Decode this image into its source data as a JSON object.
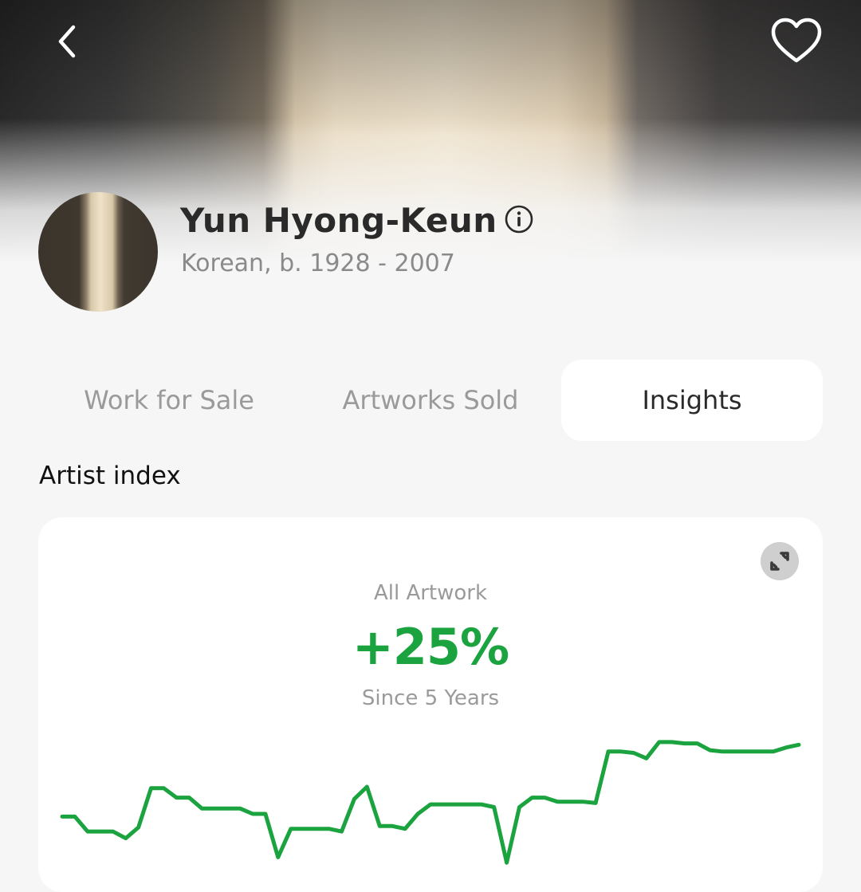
{
  "header": {
    "back_icon": "chevron-left-icon",
    "favorite_icon": "heart-outline-icon"
  },
  "artist": {
    "name": "Yun Hyong-Keun",
    "meta": "Korean, b. 1928 - 2007",
    "info_icon": "info-circle-icon"
  },
  "tabs": [
    {
      "label": "Work for Sale",
      "active": false
    },
    {
      "label": "Artworks Sold",
      "active": false
    },
    {
      "label": "Insights",
      "active": true
    }
  ],
  "section": {
    "title": "Artist index"
  },
  "index_card": {
    "label": "All Artwork",
    "value": "+25%",
    "period": "Since 5 Years",
    "expand_icon": "expand-icon",
    "accent_color": "#1aa33f"
  },
  "chart_data": {
    "type": "line",
    "title": "",
    "xlabel": "",
    "ylabel": "",
    "ylim": [
      0,
      100
    ],
    "grid": false,
    "legend": "none",
    "series": [
      {
        "color": "#1aa33f",
        "values": [
          38,
          38,
          27,
          27,
          27,
          22,
          30,
          59,
          59,
          52,
          52,
          44,
          44,
          44,
          44,
          40,
          40,
          8,
          29,
          29,
          29,
          29,
          27,
          51,
          60,
          31,
          31,
          29,
          40,
          47,
          47,
          47,
          47,
          47,
          45,
          4,
          45,
          52,
          52,
          49,
          49,
          49,
          48,
          86,
          86,
          85,
          81,
          93,
          93,
          92,
          92,
          87,
          86,
          86,
          86,
          86,
          86,
          89,
          91
        ]
      }
    ]
  }
}
